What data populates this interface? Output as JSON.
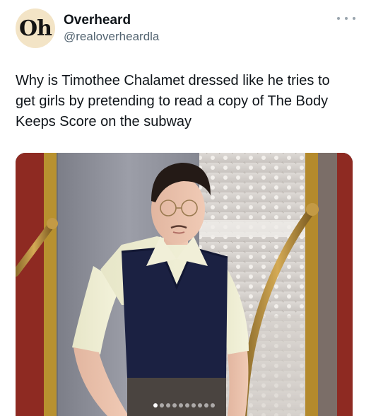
{
  "author": {
    "avatar_text": "Oh",
    "display_name": "Overheard",
    "handle": "@realoverheardla"
  },
  "menu": {
    "icon": "more-horizontal-icon"
  },
  "tweet": {
    "text": "Why is Timothee Chalamet dressed like he tries to get girls by pretending to read a copy of The Body Keeps Score on the subway"
  },
  "media": {
    "page_count": 10,
    "active_page": 1
  },
  "colors": {
    "text": "#0f1419",
    "secondary_text": "#536471",
    "avatar_bg": "#f3e4c6"
  }
}
